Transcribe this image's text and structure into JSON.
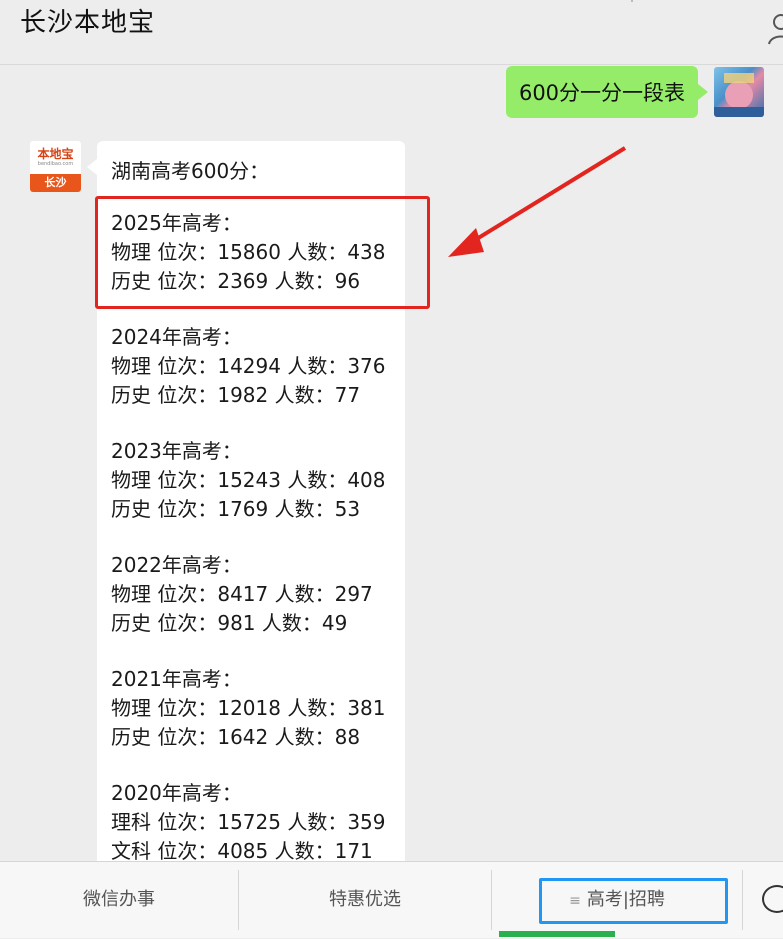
{
  "header": {
    "title": "长沙本地宝",
    "profile_icon": "person-icon"
  },
  "outgoing_message": {
    "text": "600分一分一段表"
  },
  "account": {
    "logo_text": "本地宝",
    "logo_sub": "bendibao.com",
    "city": "长沙"
  },
  "incoming_message": {
    "intro": "湖南高考600分：",
    "years": [
      {
        "title": "2025年高考：",
        "line1": "物理 位次：15860 人数：438",
        "line2": "历史 位次：2369 人数：96"
      },
      {
        "title": "2024年高考：",
        "line1": "物理 位次：14294 人数：376",
        "line2": "历史 位次：1982 人数：77"
      },
      {
        "title": "2023年高考：",
        "line1": "物理 位次：15243 人数：408",
        "line2": "历史 位次：1769 人数：53"
      },
      {
        "title": "2022年高考：",
        "line1": "物理 位次：8417 人数：297",
        "line2": "历史 位次：981 人数：49"
      },
      {
        "title": "2021年高考：",
        "line1": "物理 位次：12018 人数：381",
        "line2": "历史 位次：1642 人数：88"
      },
      {
        "title": "2020年高考：",
        "line1": "理科 位次：15725 人数：359",
        "line2": "文科 位次：4085 人数：171"
      }
    ]
  },
  "menu": {
    "items": [
      "微信办事",
      "特惠优选",
      "高考|招聘"
    ],
    "lines_icon": "≡",
    "keyboard_icon": "keyboard-icon"
  },
  "colors": {
    "outgoing_bubble": "#95ec69",
    "highlight_red": "#e3251f",
    "menu_highlight_blue": "#2196f3",
    "active_indicator": "#2ab04f"
  }
}
